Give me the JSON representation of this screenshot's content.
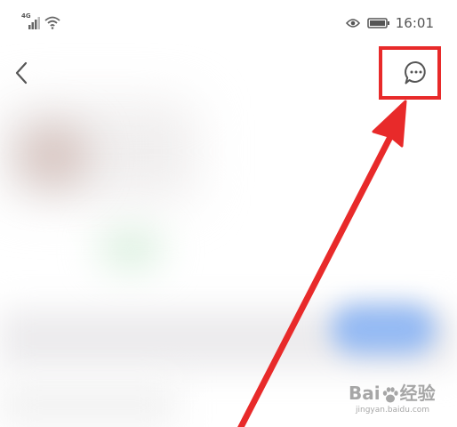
{
  "status_bar": {
    "network_type": "4G",
    "time": "16:01",
    "icons": [
      "signal-icon",
      "wifi-icon",
      "eye-icon",
      "battery-icon"
    ]
  },
  "nav_bar": {
    "back_icon": "chevron-left-icon",
    "comment_icon": "chat-bubble-icon"
  },
  "annotation": {
    "highlight_color": "#e82a2a",
    "arrow_color": "#e82a2a"
  },
  "watermark": {
    "logo_text_left": "Bai",
    "logo_text_right": "经验",
    "sub_text": "jingyan.baidu.com"
  },
  "colors": {
    "background": "#ffffff",
    "icon_gray": "#555555",
    "accent_blue": "#93b9f3",
    "accent_green": "#d3ecd8"
  }
}
